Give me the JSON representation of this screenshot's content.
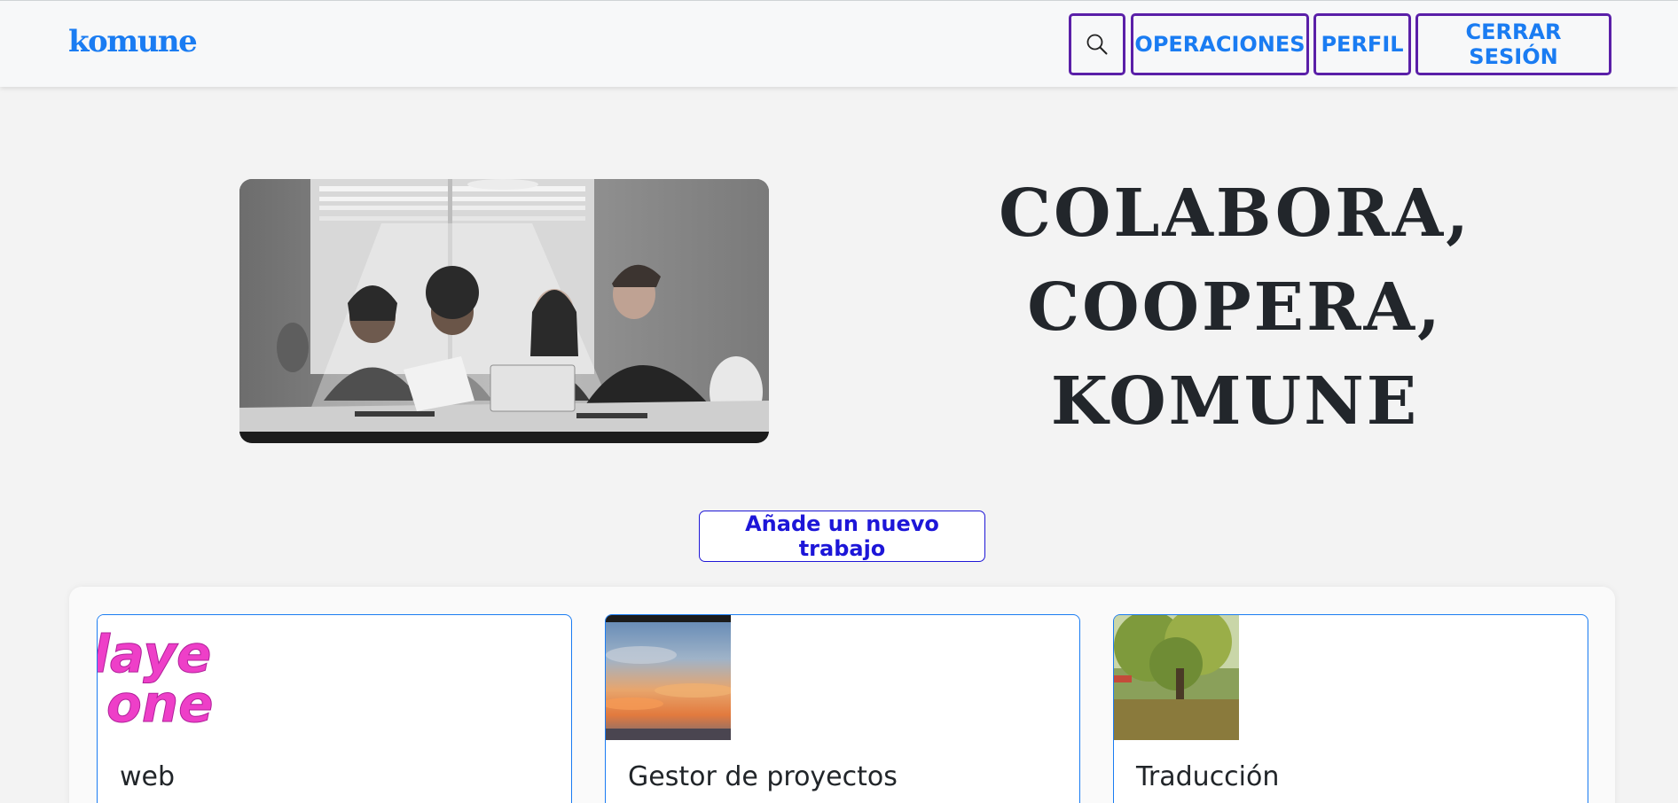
{
  "header": {
    "brand": "komune",
    "search_icon": "search-icon",
    "nav": [
      "OPERACIONES",
      "PERFIL",
      "CERRAR SESIÓN"
    ]
  },
  "hero": {
    "image": "grayscale-team-meeting-illustration",
    "title_lines": [
      "COLABORA,",
      "COOPERA,",
      "KOMUNE"
    ]
  },
  "actions": {
    "add_job_label": "Añade un nuevo trabajo"
  },
  "jobs": [
    {
      "title": "web",
      "thumb_text": [
        "laye",
        "one"
      ]
    },
    {
      "title": "Gestor de proyectos",
      "thumb": "sunset-sky-photo"
    },
    {
      "title": "Traducción",
      "thumb": "park-tree-photo"
    }
  ],
  "colors": {
    "brand": "#1a7cf2",
    "nav_border": "#5a1fa8",
    "add_button": "#1d16d8",
    "thumb_pink": "#ee3fc8"
  }
}
